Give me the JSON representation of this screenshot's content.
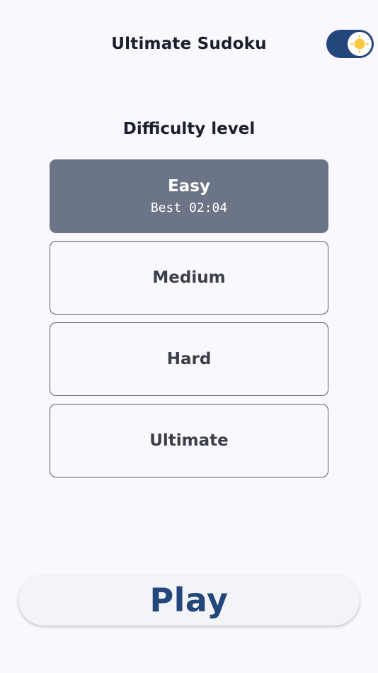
{
  "header": {
    "title": "Ultimate Sudoku",
    "theme_toggle_icon": "sun-icon",
    "theme_toggle_on": true
  },
  "difficulty": {
    "title": "Difficulty level",
    "levels": [
      {
        "name": "Easy",
        "best": "Best 02:04",
        "selected": true
      },
      {
        "name": "Medium",
        "selected": false
      },
      {
        "name": "Hard",
        "selected": false
      },
      {
        "name": "Ultimate",
        "selected": false
      }
    ]
  },
  "play": {
    "label": "Play"
  },
  "colors": {
    "background": "#f8f8fe",
    "accent": "#23477a",
    "selected_card": "#6c7587",
    "sun": "#fcc93e"
  }
}
